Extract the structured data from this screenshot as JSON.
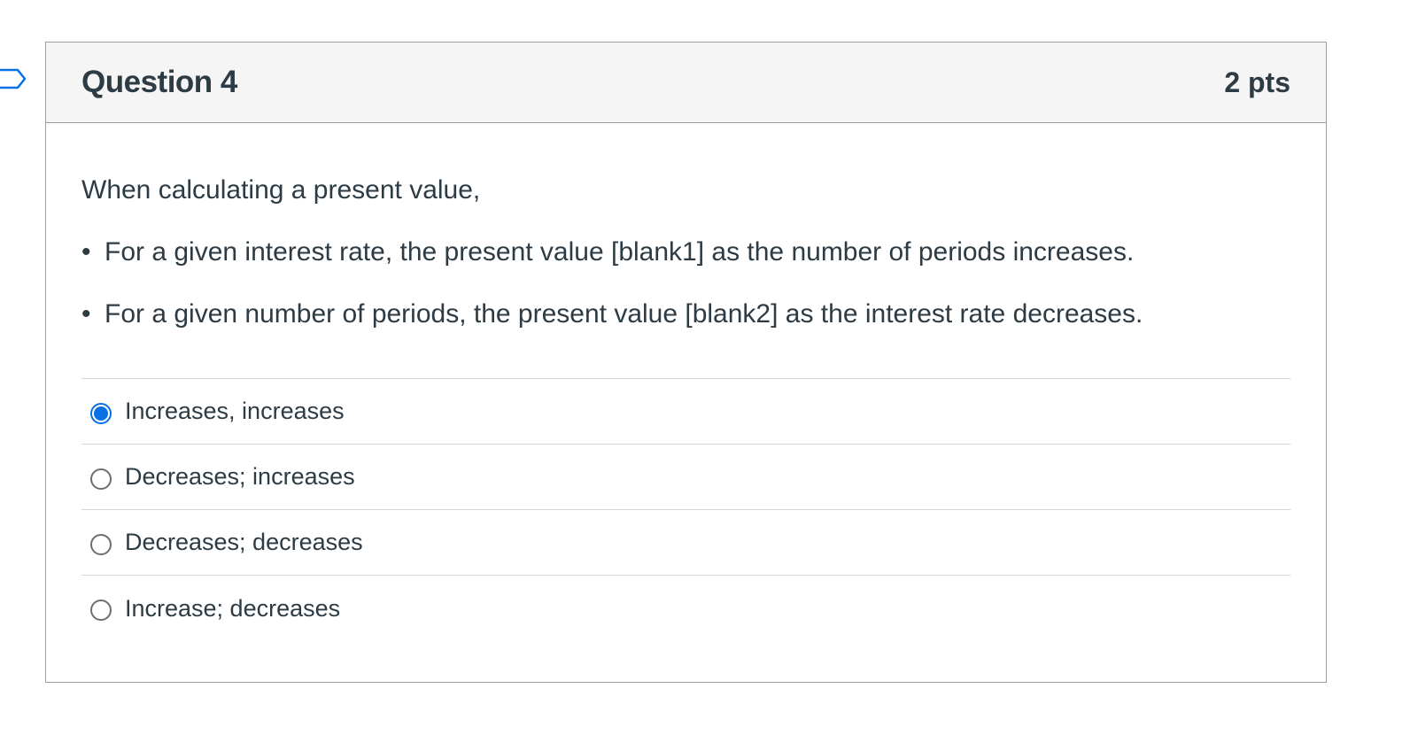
{
  "question": {
    "title": "Question 4",
    "points": "2 pts",
    "intro": "When calculating a present value,",
    "bullets": [
      "For a given interest rate, the present value [blank1] as the number of periods increases.",
      "For a given number of periods, the present value [blank2] as the interest rate decreases."
    ],
    "bullet_glyph": "•"
  },
  "answers": [
    {
      "label": "Increases, increases",
      "selected": true
    },
    {
      "label": "Decreases; increases",
      "selected": false
    },
    {
      "label": "Decreases; decreases",
      "selected": false
    },
    {
      "label": "Increase; decreases",
      "selected": false
    }
  ],
  "colors": {
    "accent": "#0770e3",
    "text": "#2d3b45",
    "header_bg": "#f5f5f5",
    "border": "#9a9ea2"
  },
  "icons": {
    "flag": "flag-question-icon"
  }
}
